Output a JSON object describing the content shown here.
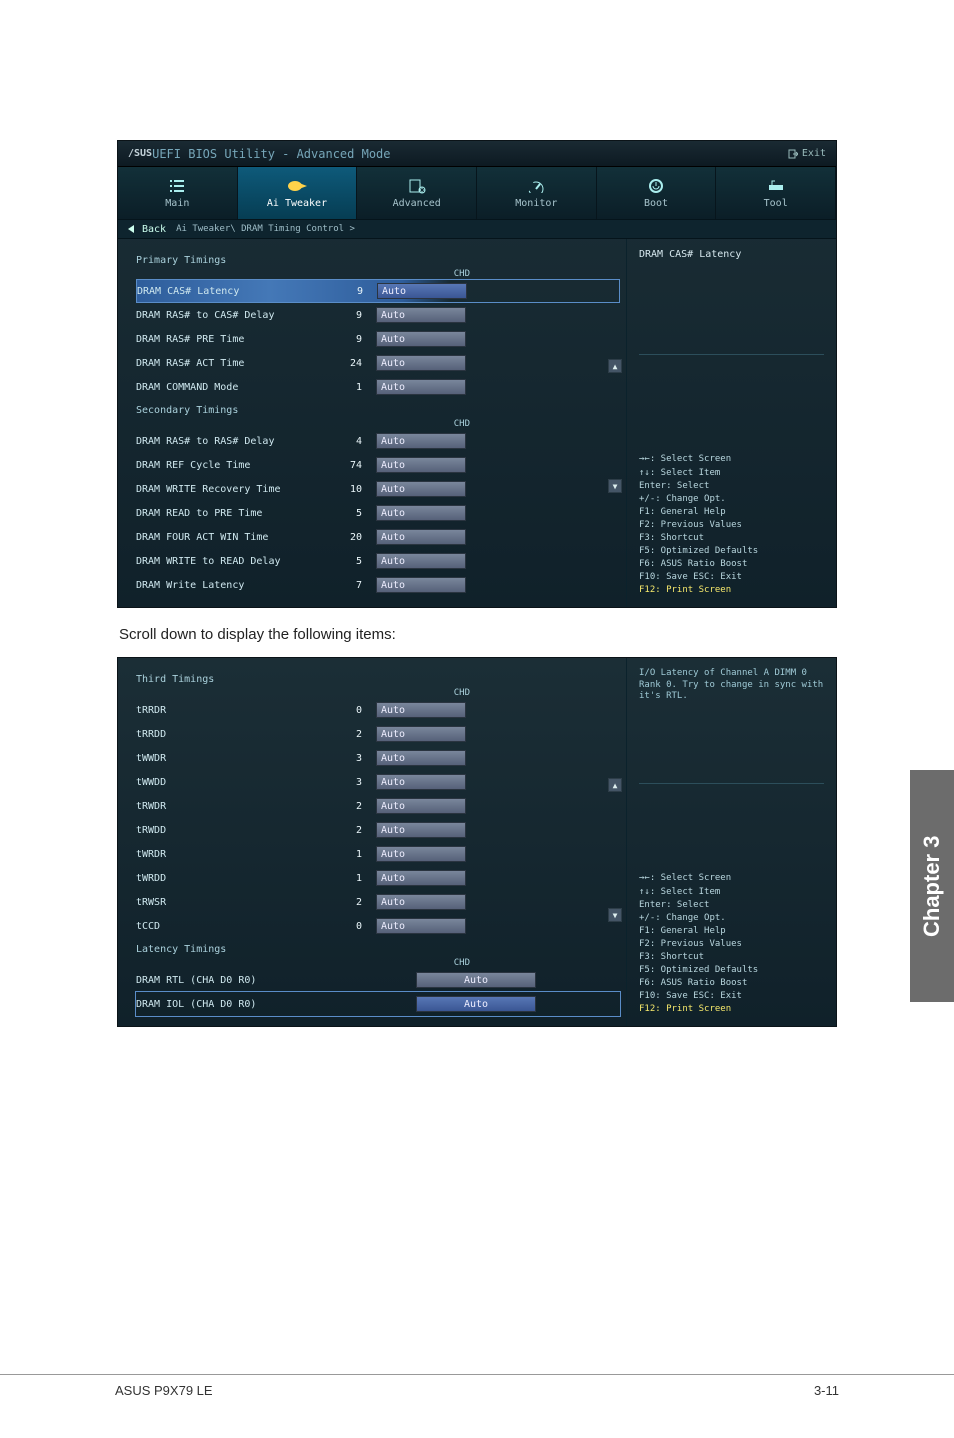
{
  "header": {
    "brand": "/SUS",
    "title": "UEFI BIOS Utility - Advanced Mode",
    "exit_label": "Exit"
  },
  "tabs": [
    {
      "label": "Main"
    },
    {
      "label": "Ai Tweaker"
    },
    {
      "label": "Advanced"
    },
    {
      "label": "Monitor"
    },
    {
      "label": "Boot"
    },
    {
      "label": "Tool"
    }
  ],
  "crumb": {
    "back": "Back",
    "path": "Ai Tweaker\\ DRAM Timing Control >"
  },
  "screen1": {
    "section_primary": "Primary Timings",
    "chd": "CHD",
    "rows_primary": [
      {
        "label": "DRAM CAS# Latency",
        "val": "9",
        "input": "Auto",
        "selected": true
      },
      {
        "label": "DRAM RAS# to CAS# Delay",
        "val": "9",
        "input": "Auto"
      },
      {
        "label": "DRAM RAS# PRE Time",
        "val": "9",
        "input": "Auto"
      },
      {
        "label": "DRAM RAS# ACT Time",
        "val": "24",
        "input": "Auto"
      },
      {
        "label": "DRAM COMMAND Mode",
        "val": "1",
        "input": "Auto"
      }
    ],
    "section_secondary": "Secondary Timings",
    "rows_secondary": [
      {
        "label": "DRAM RAS# to RAS# Delay",
        "val": "4",
        "input": "Auto"
      },
      {
        "label": "DRAM REF Cycle Time",
        "val": "74",
        "input": "Auto"
      },
      {
        "label": "DRAM WRITE Recovery Time",
        "val": "10",
        "input": "Auto"
      },
      {
        "label": "DRAM READ to PRE Time",
        "val": "5",
        "input": "Auto"
      },
      {
        "label": "DRAM FOUR ACT WIN Time",
        "val": "20",
        "input": "Auto"
      },
      {
        "label": "DRAM WRITE to READ Delay",
        "val": "5",
        "input": "Auto"
      },
      {
        "label": "DRAM Write Latency",
        "val": "7",
        "input": "Auto"
      }
    ],
    "help_title": "DRAM CAS# Latency",
    "help_keys": [
      {
        "t": "→←: Select Screen"
      },
      {
        "t": "↑↓: Select Item"
      },
      {
        "t": "Enter: Select"
      },
      {
        "t": "+/-: Change Opt."
      },
      {
        "t": "F1: General Help"
      },
      {
        "t": "F2: Previous Values"
      },
      {
        "t": "F3: Shortcut"
      },
      {
        "t": "F5: Optimized Defaults"
      },
      {
        "t": "F6: ASUS Ratio Boost"
      },
      {
        "t": "F10: Save  ESC: Exit"
      },
      {
        "t": "F12: Print Screen",
        "hot": true
      }
    ]
  },
  "caption": "Scroll down to display the following items:",
  "screen2": {
    "section_third": "Third Timings",
    "chd": "CHD",
    "rows_third": [
      {
        "label": "tRRDR",
        "val": "0",
        "input": "Auto"
      },
      {
        "label": "tRRDD",
        "val": "2",
        "input": "Auto"
      },
      {
        "label": "tWWDR",
        "val": "3",
        "input": "Auto"
      },
      {
        "label": "tWWDD",
        "val": "3",
        "input": "Auto"
      },
      {
        "label": "tRWDR",
        "val": "2",
        "input": "Auto"
      },
      {
        "label": "tRWDD",
        "val": "2",
        "input": "Auto"
      },
      {
        "label": "tWRDR",
        "val": "1",
        "input": "Auto"
      },
      {
        "label": "tWRDD",
        "val": "1",
        "input": "Auto"
      },
      {
        "label": "tRWSR",
        "val": "2",
        "input": "Auto"
      },
      {
        "label": "tCCD",
        "val": "0",
        "input": "Auto"
      }
    ],
    "section_latency": "Latency Timings",
    "rows_latency": [
      {
        "label": "DRAM RTL (CHA D0 R0)",
        "input": "Auto"
      },
      {
        "label": "DRAM IOL (CHA D0 R0)",
        "input": "Auto",
        "selected": true
      }
    ],
    "help_desc": "I/O Latency of Channel A DIMM 0 Rank 0. Try to change in sync with it's RTL.",
    "help_keys": [
      {
        "t": "→←: Select Screen"
      },
      {
        "t": "↑↓: Select Item"
      },
      {
        "t": "Enter: Select"
      },
      {
        "t": "+/-: Change Opt."
      },
      {
        "t": "F1: General Help"
      },
      {
        "t": "F2: Previous Values"
      },
      {
        "t": "F3: Shortcut"
      },
      {
        "t": "F5: Optimized Defaults"
      },
      {
        "t": "F6: ASUS Ratio Boost"
      },
      {
        "t": "F10: Save  ESC: Exit"
      },
      {
        "t": "F12: Print Screen",
        "hot": true
      }
    ]
  },
  "side_tab": "Chapter 3",
  "footer": {
    "left": "ASUS P9X79 LE",
    "right": "3-11"
  }
}
